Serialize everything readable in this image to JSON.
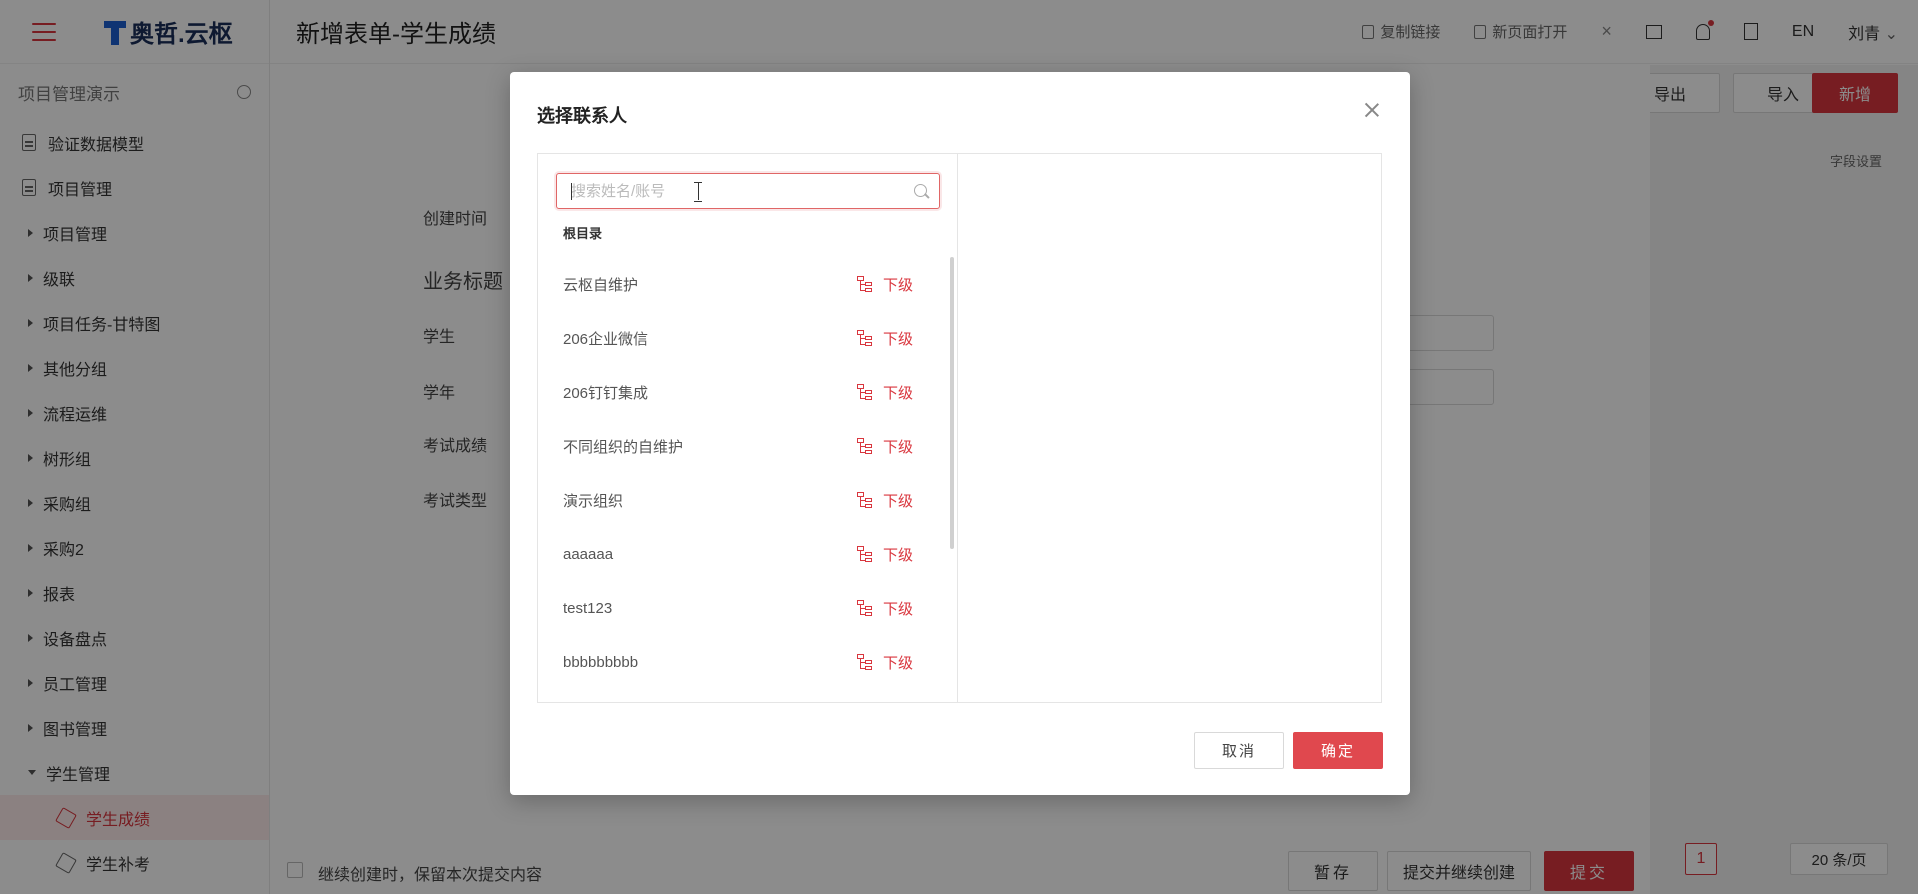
{
  "app": {
    "brand": "奥哲.云枢",
    "project_name": "项目管理演示"
  },
  "sidebar": {
    "items": [
      {
        "label": "验证数据模型"
      },
      {
        "label": "项目管理"
      },
      {
        "label": "项目管理"
      },
      {
        "label": "级联"
      },
      {
        "label": "项目任务-甘特图"
      },
      {
        "label": "其他分组"
      },
      {
        "label": "流程运维"
      },
      {
        "label": "树形组"
      },
      {
        "label": "采购组"
      },
      {
        "label": "采购2"
      },
      {
        "label": "报表"
      },
      {
        "label": "设备盘点"
      },
      {
        "label": "员工管理"
      },
      {
        "label": "图书管理"
      },
      {
        "label": "学生管理"
      },
      {
        "label": "学生成绩"
      },
      {
        "label": "学生补考"
      }
    ]
  },
  "topbar": {
    "title": "新增表单-学生成绩",
    "copy_link": "复制链接",
    "open_new_page": "新页面打开",
    "language": "EN",
    "user": "刘青"
  },
  "list_toolbar": {
    "export": "导出",
    "import": "导入",
    "add": "新增",
    "field_settings": "字段设置"
  },
  "form": {
    "created_time_label": "创建时间",
    "section_title": "业务标题",
    "student_label": "学生",
    "school_year_label": "学年",
    "exam_score_label": "考试成绩",
    "exam_type_label": "考试类型",
    "keep_content_label": "继续创建时，保留本次提交内容",
    "save_draft": "暂存",
    "submit_and_continue": "提交并继续创建",
    "submit": "提交"
  },
  "pagination": {
    "current_page": "1",
    "page_size": "20 条/页"
  },
  "modal": {
    "title": "选择联系人",
    "search_placeholder": "搜索姓名/账号",
    "root_label": "根目录",
    "sub_label": "下级",
    "orgs": [
      {
        "name": "云枢自维护"
      },
      {
        "name": "206企业微信"
      },
      {
        "name": "206钉钉集成"
      },
      {
        "name": "不同组织的自维护"
      },
      {
        "name": "演示组织"
      },
      {
        "name": "aaaaaa"
      },
      {
        "name": "test123"
      },
      {
        "name": "bbbbbbbbb"
      }
    ],
    "cancel": "取消",
    "confirm": "确定"
  },
  "colors": {
    "accent": "#d9363e",
    "overlay": "rgba(0,0,0,0.45)"
  }
}
